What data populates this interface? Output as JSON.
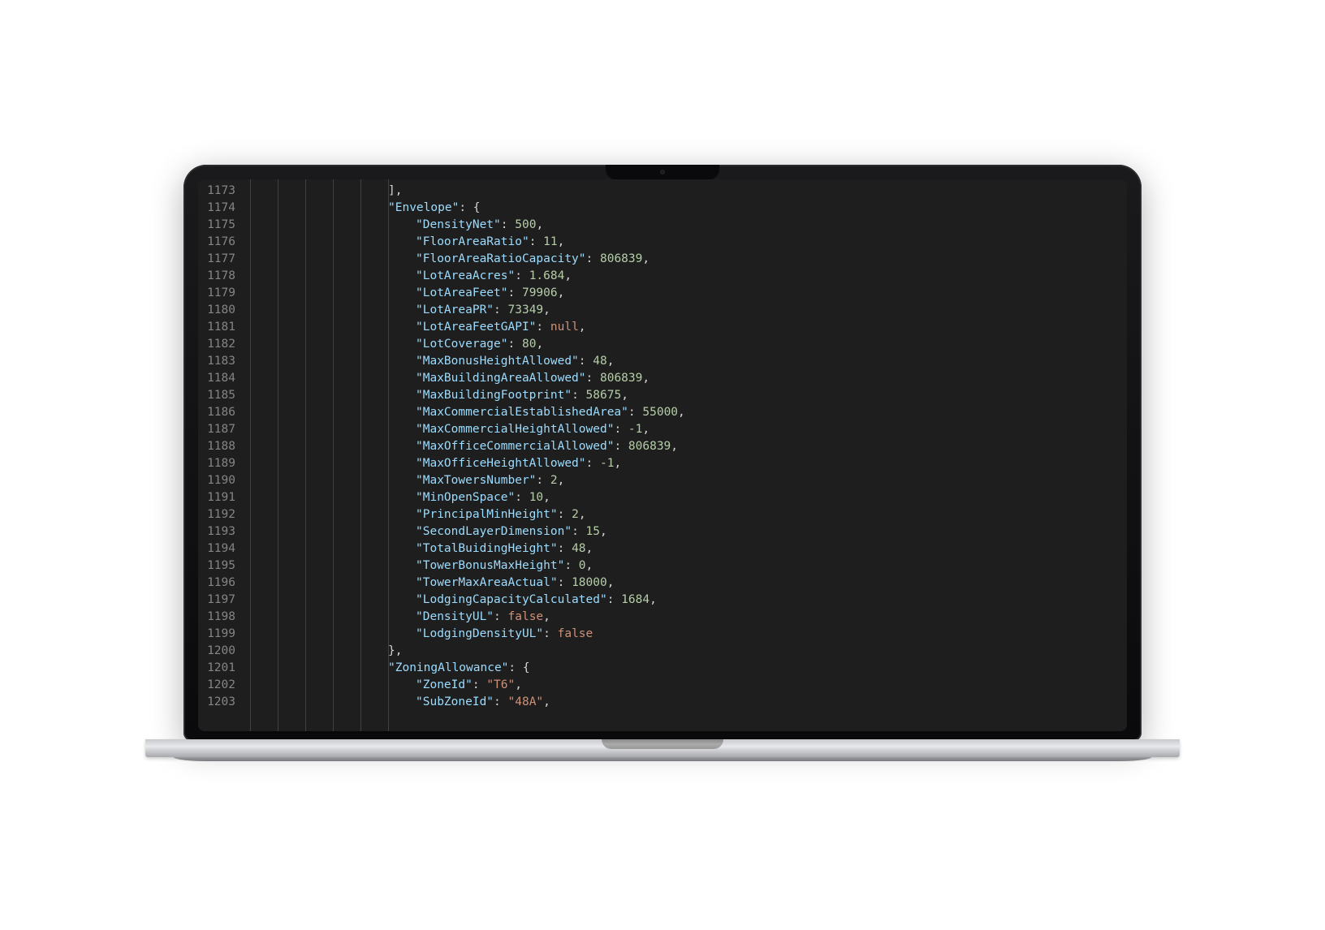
{
  "editor": {
    "startLine": 1173,
    "indentSize": 4,
    "lines": [
      {
        "num": 1173,
        "indent": 5,
        "tokens": [
          {
            "t": "brace",
            "v": "],"
          }
        ]
      },
      {
        "num": 1174,
        "indent": 5,
        "tokens": [
          {
            "t": "key",
            "v": "\"Envelope\""
          },
          {
            "t": "punct",
            "v": ": "
          },
          {
            "t": "brace",
            "v": "{"
          }
        ]
      },
      {
        "num": 1175,
        "indent": 6,
        "tokens": [
          {
            "t": "key",
            "v": "\"DensityNet\""
          },
          {
            "t": "punct",
            "v": ": "
          },
          {
            "t": "number",
            "v": "500"
          },
          {
            "t": "punct",
            "v": ","
          }
        ]
      },
      {
        "num": 1176,
        "indent": 6,
        "tokens": [
          {
            "t": "key",
            "v": "\"FloorAreaRatio\""
          },
          {
            "t": "punct",
            "v": ": "
          },
          {
            "t": "number",
            "v": "11"
          },
          {
            "t": "punct",
            "v": ","
          }
        ]
      },
      {
        "num": 1177,
        "indent": 6,
        "tokens": [
          {
            "t": "key",
            "v": "\"FloorAreaRatioCapacity\""
          },
          {
            "t": "punct",
            "v": ": "
          },
          {
            "t": "number",
            "v": "806839"
          },
          {
            "t": "punct",
            "v": ","
          }
        ]
      },
      {
        "num": 1178,
        "indent": 6,
        "tokens": [
          {
            "t": "key",
            "v": "\"LotAreaAcres\""
          },
          {
            "t": "punct",
            "v": ": "
          },
          {
            "t": "number",
            "v": "1.684"
          },
          {
            "t": "punct",
            "v": ","
          }
        ]
      },
      {
        "num": 1179,
        "indent": 6,
        "tokens": [
          {
            "t": "key",
            "v": "\"LotAreaFeet\""
          },
          {
            "t": "punct",
            "v": ": "
          },
          {
            "t": "number",
            "v": "79906"
          },
          {
            "t": "punct",
            "v": ","
          }
        ]
      },
      {
        "num": 1180,
        "indent": 6,
        "tokens": [
          {
            "t": "key",
            "v": "\"LotAreaPR\""
          },
          {
            "t": "punct",
            "v": ": "
          },
          {
            "t": "number",
            "v": "73349"
          },
          {
            "t": "punct",
            "v": ","
          }
        ]
      },
      {
        "num": 1181,
        "indent": 6,
        "tokens": [
          {
            "t": "key",
            "v": "\"LotAreaFeetGAPI\""
          },
          {
            "t": "punct",
            "v": ": "
          },
          {
            "t": "null",
            "v": "null"
          },
          {
            "t": "punct",
            "v": ","
          }
        ]
      },
      {
        "num": 1182,
        "indent": 6,
        "tokens": [
          {
            "t": "key",
            "v": "\"LotCoverage\""
          },
          {
            "t": "punct",
            "v": ": "
          },
          {
            "t": "number",
            "v": "80"
          },
          {
            "t": "punct",
            "v": ","
          }
        ]
      },
      {
        "num": 1183,
        "indent": 6,
        "tokens": [
          {
            "t": "key",
            "v": "\"MaxBonusHeightAllowed\""
          },
          {
            "t": "punct",
            "v": ": "
          },
          {
            "t": "number",
            "v": "48"
          },
          {
            "t": "punct",
            "v": ","
          }
        ]
      },
      {
        "num": 1184,
        "indent": 6,
        "tokens": [
          {
            "t": "key",
            "v": "\"MaxBuildingAreaAllowed\""
          },
          {
            "t": "punct",
            "v": ": "
          },
          {
            "t": "number",
            "v": "806839"
          },
          {
            "t": "punct",
            "v": ","
          }
        ]
      },
      {
        "num": 1185,
        "indent": 6,
        "tokens": [
          {
            "t": "key",
            "v": "\"MaxBuildingFootprint\""
          },
          {
            "t": "punct",
            "v": ": "
          },
          {
            "t": "number",
            "v": "58675"
          },
          {
            "t": "punct",
            "v": ","
          }
        ]
      },
      {
        "num": 1186,
        "indent": 6,
        "tokens": [
          {
            "t": "key",
            "v": "\"MaxCommercialEstablishedArea\""
          },
          {
            "t": "punct",
            "v": ": "
          },
          {
            "t": "number",
            "v": "55000"
          },
          {
            "t": "punct",
            "v": ","
          }
        ]
      },
      {
        "num": 1187,
        "indent": 6,
        "tokens": [
          {
            "t": "key",
            "v": "\"MaxCommercialHeightAllowed\""
          },
          {
            "t": "punct",
            "v": ": "
          },
          {
            "t": "number",
            "v": "-1"
          },
          {
            "t": "punct",
            "v": ","
          }
        ]
      },
      {
        "num": 1188,
        "indent": 6,
        "tokens": [
          {
            "t": "key",
            "v": "\"MaxOfficeCommercialAllowed\""
          },
          {
            "t": "punct",
            "v": ": "
          },
          {
            "t": "number",
            "v": "806839"
          },
          {
            "t": "punct",
            "v": ","
          }
        ]
      },
      {
        "num": 1189,
        "indent": 6,
        "tokens": [
          {
            "t": "key",
            "v": "\"MaxOfficeHeightAllowed\""
          },
          {
            "t": "punct",
            "v": ": "
          },
          {
            "t": "number",
            "v": "-1"
          },
          {
            "t": "punct",
            "v": ","
          }
        ]
      },
      {
        "num": 1190,
        "indent": 6,
        "tokens": [
          {
            "t": "key",
            "v": "\"MaxTowersNumber\""
          },
          {
            "t": "punct",
            "v": ": "
          },
          {
            "t": "number",
            "v": "2"
          },
          {
            "t": "punct",
            "v": ","
          }
        ]
      },
      {
        "num": 1191,
        "indent": 6,
        "tokens": [
          {
            "t": "key",
            "v": "\"MinOpenSpace\""
          },
          {
            "t": "punct",
            "v": ": "
          },
          {
            "t": "number",
            "v": "10"
          },
          {
            "t": "punct",
            "v": ","
          }
        ]
      },
      {
        "num": 1192,
        "indent": 6,
        "tokens": [
          {
            "t": "key",
            "v": "\"PrincipalMinHeight\""
          },
          {
            "t": "punct",
            "v": ": "
          },
          {
            "t": "number",
            "v": "2"
          },
          {
            "t": "punct",
            "v": ","
          }
        ]
      },
      {
        "num": 1193,
        "indent": 6,
        "tokens": [
          {
            "t": "key",
            "v": "\"SecondLayerDimension\""
          },
          {
            "t": "punct",
            "v": ": "
          },
          {
            "t": "number",
            "v": "15"
          },
          {
            "t": "punct",
            "v": ","
          }
        ]
      },
      {
        "num": 1194,
        "indent": 6,
        "tokens": [
          {
            "t": "key",
            "v": "\"TotalBuidingHeight\""
          },
          {
            "t": "punct",
            "v": ": "
          },
          {
            "t": "number",
            "v": "48"
          },
          {
            "t": "punct",
            "v": ","
          }
        ]
      },
      {
        "num": 1195,
        "indent": 6,
        "tokens": [
          {
            "t": "key",
            "v": "\"TowerBonusMaxHeight\""
          },
          {
            "t": "punct",
            "v": ": "
          },
          {
            "t": "number",
            "v": "0"
          },
          {
            "t": "punct",
            "v": ","
          }
        ]
      },
      {
        "num": 1196,
        "indent": 6,
        "tokens": [
          {
            "t": "key",
            "v": "\"TowerMaxAreaActual\""
          },
          {
            "t": "punct",
            "v": ": "
          },
          {
            "t": "number",
            "v": "18000"
          },
          {
            "t": "punct",
            "v": ","
          }
        ]
      },
      {
        "num": 1197,
        "indent": 6,
        "tokens": [
          {
            "t": "key",
            "v": "\"LodgingCapacityCalculated\""
          },
          {
            "t": "punct",
            "v": ": "
          },
          {
            "t": "number",
            "v": "1684"
          },
          {
            "t": "punct",
            "v": ","
          }
        ]
      },
      {
        "num": 1198,
        "indent": 6,
        "tokens": [
          {
            "t": "key",
            "v": "\"DensityUL\""
          },
          {
            "t": "punct",
            "v": ": "
          },
          {
            "t": "bool",
            "v": "false"
          },
          {
            "t": "punct",
            "v": ","
          }
        ]
      },
      {
        "num": 1199,
        "indent": 6,
        "tokens": [
          {
            "t": "key",
            "v": "\"LodgingDensityUL\""
          },
          {
            "t": "punct",
            "v": ": "
          },
          {
            "t": "bool",
            "v": "false"
          }
        ]
      },
      {
        "num": 1200,
        "indent": 5,
        "tokens": [
          {
            "t": "brace",
            "v": "},"
          }
        ]
      },
      {
        "num": 1201,
        "indent": 5,
        "tokens": [
          {
            "t": "key",
            "v": "\"ZoningAllowance\""
          },
          {
            "t": "punct",
            "v": ": "
          },
          {
            "t": "brace",
            "v": "{"
          }
        ]
      },
      {
        "num": 1202,
        "indent": 6,
        "tokens": [
          {
            "t": "key",
            "v": "\"ZoneId\""
          },
          {
            "t": "punct",
            "v": ": "
          },
          {
            "t": "string",
            "v": "\"T6\""
          },
          {
            "t": "punct",
            "v": ","
          }
        ]
      },
      {
        "num": 1203,
        "indent": 6,
        "tokens": [
          {
            "t": "key",
            "v": "\"SubZoneId\""
          },
          {
            "t": "punct",
            "v": ": "
          },
          {
            "t": "string",
            "v": "\"48A\""
          },
          {
            "t": "punct",
            "v": ","
          }
        ]
      }
    ],
    "guideLevels": [
      0,
      1,
      2,
      3,
      4,
      5
    ]
  }
}
